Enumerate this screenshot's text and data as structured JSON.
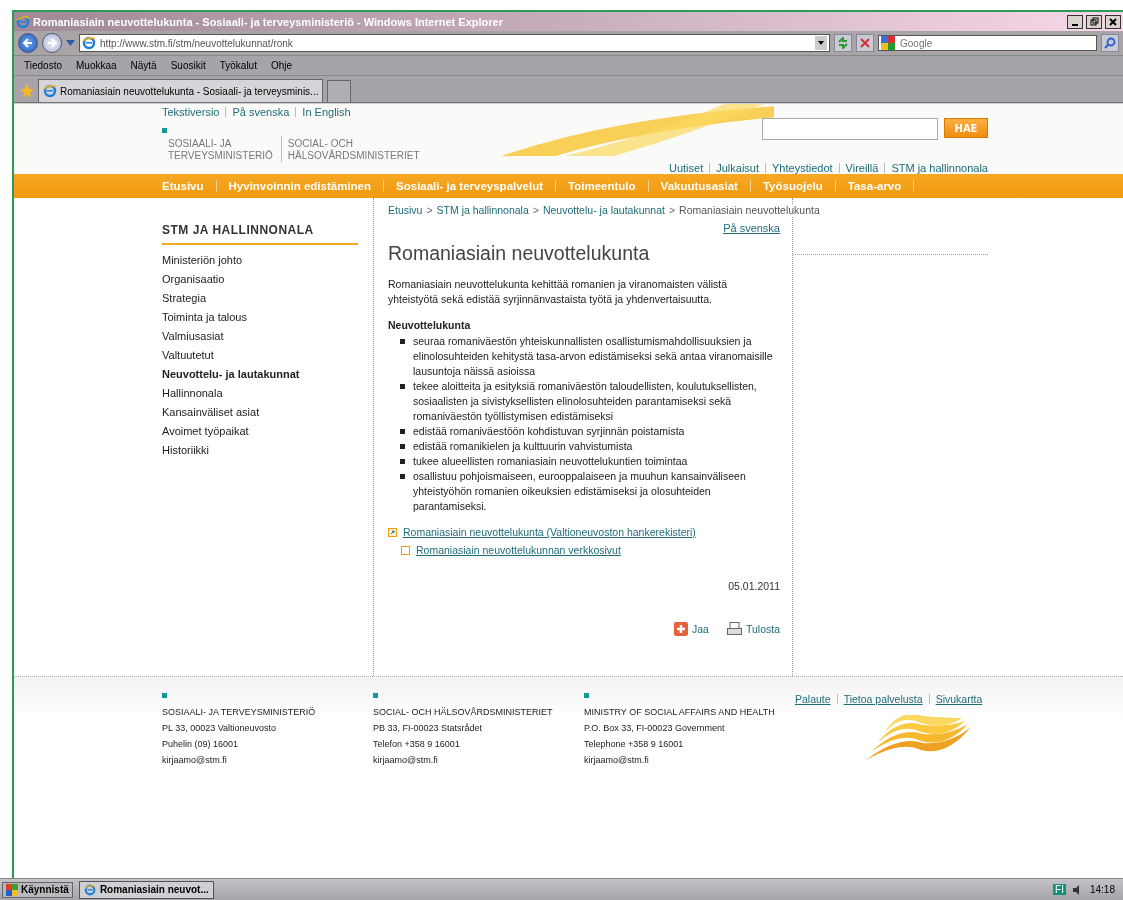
{
  "window": {
    "title": "Romaniasiain neuvottelukunta - Sosiaali- ja terveysministeriö - Windows Internet Explorer"
  },
  "address": {
    "url": "http://www.stm.fi/stm/neuvottelukunnat/ronk"
  },
  "search": {
    "placeholder": "Google"
  },
  "menu": [
    "Tiedosto",
    "Muokkaa",
    "Näytä",
    "Suosikit",
    "Työkalut",
    "Ohje"
  ],
  "tabs": [
    {
      "label": "Romaniasiain neuvottelukunta - Sosiaali- ja terveysminis...",
      "selected": true
    }
  ],
  "site": {
    "top_links": [
      "Tekstiversio",
      "På svenska",
      "In English"
    ],
    "logo": [
      {
        "line1": "SOSIAALI- JA",
        "line2": "TERVEYSMINISTERIÖ"
      },
      {
        "line1": "SOCIAL- OCH",
        "line2": "HÄLSOVÅRDSMINISTERIET"
      }
    ],
    "search_button": "HAE",
    "utility_links": [
      "Uutiset",
      "Julkaisut",
      "Yhteystiedot",
      "Vireillä",
      "STM ja hallinnonala"
    ],
    "main_nav": [
      "Etusivu",
      "Hyvinvoinnin edistäminen",
      "Sosiaali- ja terveyspalvelut",
      "Toimeentulo",
      "Vakuutusasiat",
      "Työsuojelu",
      "Tasa-arvo"
    ],
    "sidebar": {
      "title": "STM JA HALLINNONALA",
      "items": [
        {
          "label": "Ministeriön johto",
          "selected": false
        },
        {
          "label": "Organisaatio",
          "selected": false
        },
        {
          "label": "Strategia",
          "selected": false
        },
        {
          "label": "Toiminta ja talous",
          "selected": false
        },
        {
          "label": "Valmiusasiat",
          "selected": false
        },
        {
          "label": "Valtuutetut",
          "selected": false
        },
        {
          "label": "Neuvottelu- ja lautakunnat",
          "selected": true
        },
        {
          "label": "Hallinnonala",
          "selected": false
        },
        {
          "label": "Kansainväliset asiat",
          "selected": false
        },
        {
          "label": "Avoimet työpaikat",
          "selected": false
        },
        {
          "label": "Historiikki",
          "selected": false
        }
      ]
    },
    "breadcrumb": [
      {
        "text": "Etusivu",
        "kind": "link"
      },
      {
        "text": ">",
        "kind": "separator"
      },
      {
        "text": "STM ja hallinnonala",
        "kind": "link"
      },
      {
        "text": ">",
        "kind": "separator"
      },
      {
        "text": "Neuvottelu- ja lautakunnat",
        "kind": "link"
      },
      {
        "text": ">",
        "kind": "separator"
      },
      {
        "text": "Romaniasiain neuvottelukunta",
        "kind": "current"
      }
    ],
    "language_link": "På svenska",
    "heading": "Romaniasiain neuvottelukunta",
    "intro": "Romaniasiain neuvottelukunta kehittää romanien ja viranomaisten välistä yhteistyötä sekä edistää syrjinnänvastaista työtä ja yhdenvertaisuutta.",
    "section_heading": "Neuvottelukunta",
    "bullets": [
      "seuraa romaniväestön yhteiskunnallisten osallistumismahdollisuuksien ja elinolosuhteiden kehitystä tasa-arvon edistämiseksi sekä antaa viranomaisille lausuntoja näissä asioissa",
      "tekee aloitteita ja esityksiä romaniväestön taloudellisten, koulutuksellisten, sosiaalisten ja sivistyksellisten elinolosuhteiden parantamiseksi sekä romaniväestön työllistymisen edistämiseksi",
      "edistää romaniväestöön kohdistuvan syrjinnän poistamista",
      "edistää romanikielen ja kulttuurin vahvistumista",
      "tukee alueellisten romaniasiain neuvottelukuntien toimintaa",
      "osallistuu pohjoismaiseen, eurooppalaiseen ja muuhun kansainväliseen yhteistyöhön romanien oikeuksien edistämiseksi ja olosuhteiden parantamiseksi."
    ],
    "links": [
      {
        "text": "Romaniasiain neuvottelukunta (Valtioneuvoston hankerekisteri)",
        "kind": "external"
      },
      {
        "text": "Romaniasiain neuvottelukunnan verkkosivut",
        "kind": "page"
      }
    ],
    "date": "05.01.2011",
    "actions": [
      {
        "label": "Jaa",
        "kind": "share"
      },
      {
        "label": "Tulosta",
        "kind": "print"
      }
    ],
    "footer": {
      "columns": [
        {
          "lines": [
            "SOSIAALI- JA TERVEYSMINISTERIÖ",
            "PL 33, 00023 Valtioneuvosto",
            "Puhelin (09) 16001",
            "kirjaamo@stm.fi"
          ]
        },
        {
          "lines": [
            "SOCIAL- OCH HÄLSOVÅRDSMINISTERIET",
            "PB 33, FI-00023 Statsrådet",
            "Telefon +358 9 16001",
            "kirjaamo@stm.fi"
          ]
        },
        {
          "lines": [
            "MINISTRY OF SOCIAL AFFAIRS AND HEALTH",
            "P.O. Box 33, FI-00023 Government",
            "Telephone +358 9 16001",
            "kirjaamo@stm.fi"
          ]
        }
      ],
      "links": [
        "Palaute",
        "Tietoa palvelusta",
        "Sivukartta"
      ]
    }
  },
  "taskbar": {
    "start": "Käynnistä",
    "task": "Romaniasiain neuvot...",
    "language": "FI",
    "time": "14:18"
  }
}
